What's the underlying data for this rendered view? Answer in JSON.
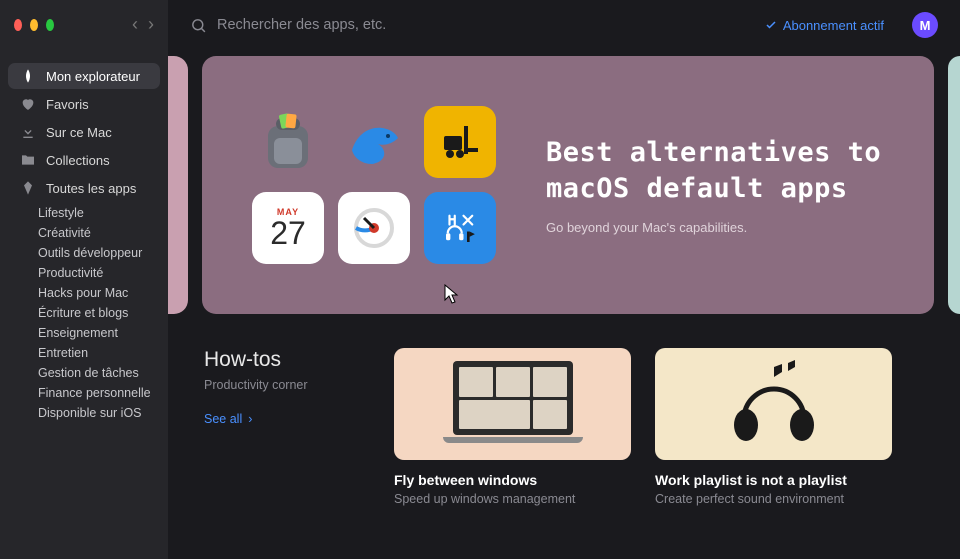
{
  "window": {
    "nav_back": "‹",
    "nav_forward": "›"
  },
  "sidebar": {
    "items": [
      {
        "icon": "explorer-icon",
        "label": "Mon explorateur",
        "active": true
      },
      {
        "icon": "heart-icon",
        "label": "Favoris"
      },
      {
        "icon": "download-icon",
        "label": "Sur ce Mac"
      },
      {
        "icon": "folder-icon",
        "label": "Collections"
      },
      {
        "icon": "diamond-icon",
        "label": "Toutes les apps"
      }
    ],
    "categories": [
      "Lifestyle",
      "Créativité",
      "Outils développeur",
      "Productivité",
      "Hacks pour Mac",
      "Écriture et blogs",
      "Enseignement",
      "Entretien",
      "Gestion de tâches",
      "Finance personnelle",
      "Disponible sur iOS"
    ]
  },
  "topbar": {
    "search_placeholder": "Rechercher des apps, etc.",
    "subscription_label": "Abonnement actif",
    "avatar_initial": "M"
  },
  "hero": {
    "title_line1": "Best alternatives to",
    "title_line2": "macOS default apps",
    "subtitle": "Go beyond your Mac's capabilities.",
    "calendar_month": "MAY",
    "calendar_day": "27"
  },
  "howtos": {
    "title": "How-tos",
    "subtitle": "Productivity corner",
    "see_all_label": "See all"
  },
  "cards": [
    {
      "title": "Fly between windows",
      "subtitle": "Speed up windows management"
    },
    {
      "title": "Work playlist is not a playlist",
      "subtitle": "Create perfect sound environment"
    }
  ]
}
